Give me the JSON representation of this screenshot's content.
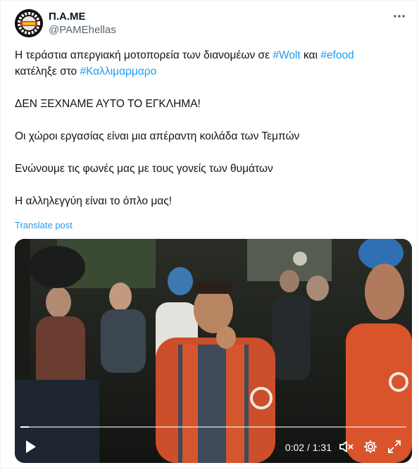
{
  "account": {
    "display_name": "Π.Α.ΜΕ",
    "handle": "@PAMEhellas",
    "avatar_icon": "pame-logo-icon"
  },
  "more_icon": "more-dots-icon",
  "post": {
    "line1_text": "Η τεράστια απεργιακή μοτοπορεία των διανομέων σε ",
    "hashtag_wolt": "#Wolt",
    "line1_and": " και ",
    "hashtag_efood": "#efood",
    "line2_text": "κατέληξε στο ",
    "hashtag_kallimarmaro": "#Καλλιμαρμαρο",
    "para2": "ΔΕΝ ΞΕΧΝΑΜΕ ΑΥΤΟ ΤΟ ΕΓΚΛΗΜΑ!",
    "para3": "Οι χώροι εργασίας είναι μια απέραντη κοιλάδα των Τεμπών",
    "para4": "Ενώνουμε τις φωνές μας με τους γονείς των θυμάτων",
    "para5": "Η αλληλεγγύη είναι το όπλο μας!"
  },
  "translate_label": "Translate post",
  "video": {
    "time_current": "0:02",
    "time_total": "1:31",
    "time_display": "0:02 / 1:31",
    "progress_fraction": 0.022,
    "icons": [
      "play-icon",
      "volume-muted-icon",
      "settings-gear-icon",
      "fullscreen-icon"
    ]
  },
  "colors": {
    "link": "#1d9bf0",
    "secondary_text": "#536471",
    "vest_orange": "#d9532b"
  }
}
